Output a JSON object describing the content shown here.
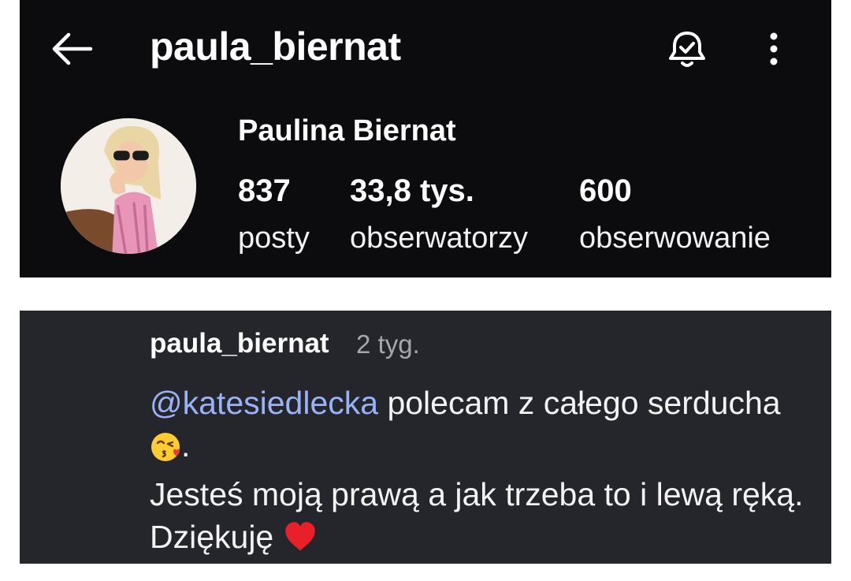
{
  "header": {
    "username": "paula_biernat",
    "back_icon": "arrow-left-icon",
    "notification_icon": "bell-check-icon",
    "menu_icon": "more-vertical-icon"
  },
  "profile": {
    "full_name": "Paulina Biernat",
    "stats": [
      {
        "value": "837",
        "label": "posty"
      },
      {
        "value": "33,8 tys.",
        "label": "obserwatorzy"
      },
      {
        "value": "600",
        "label": "obserwowanie"
      }
    ]
  },
  "comment": {
    "username": "paula_biernat",
    "time": "2 tyg.",
    "mention": "@katesiedlecka",
    "text_part1": " polecam z całego serducha ",
    "text_part2": ".",
    "text_part3": "Jesteś moją prawą a jak trzeba to i lewą ręką. Dziękuję ",
    "emoji1": "kissing-heart-emoji",
    "emoji2": "red-heart-emoji"
  },
  "colors": {
    "top_background": "#0c0c0e",
    "comment_background": "#25262b",
    "mention": "#9ab3f8",
    "timestamp": "#a6a7ab"
  }
}
